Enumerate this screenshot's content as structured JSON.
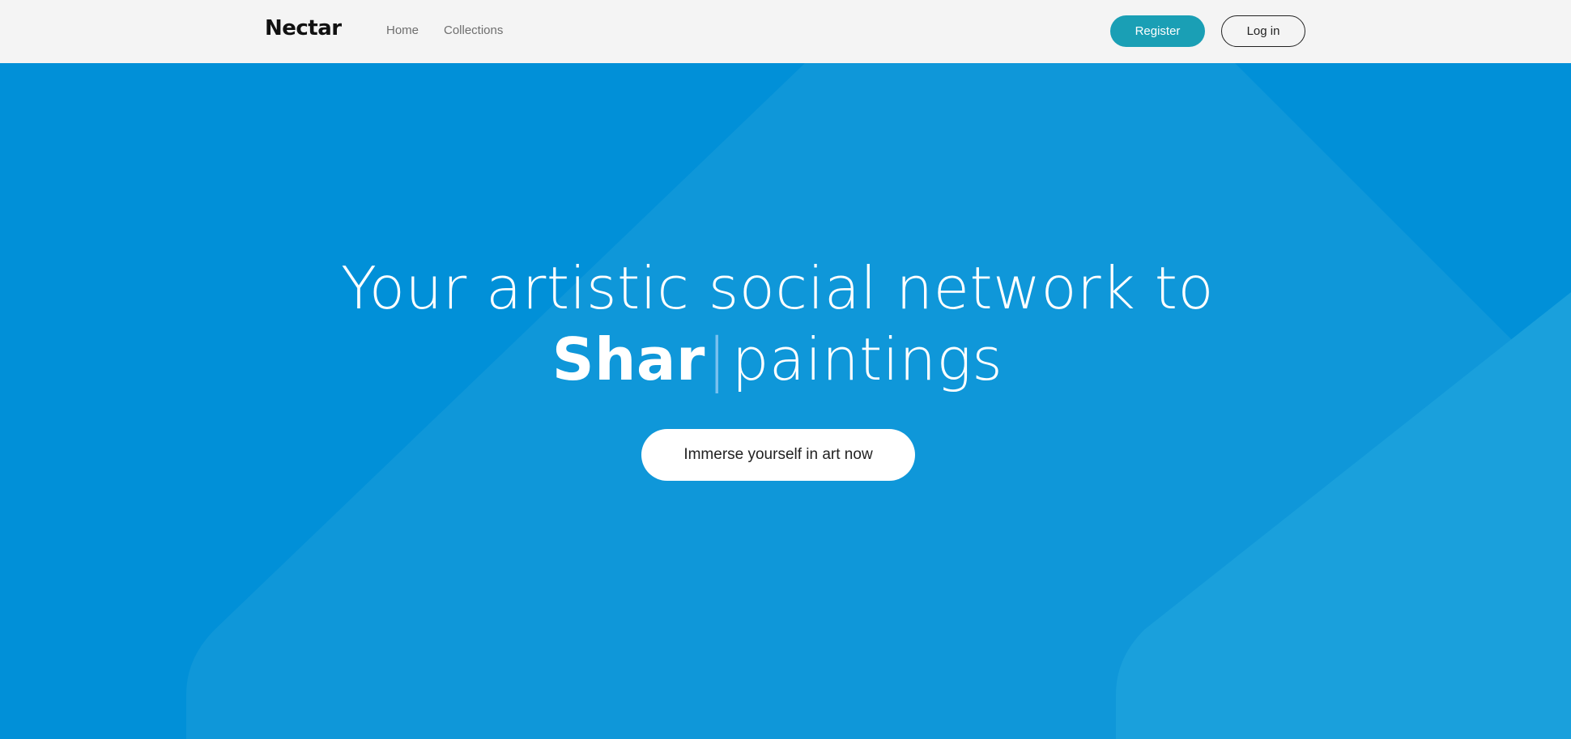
{
  "nav": {
    "logo": "Nectar",
    "links": [
      "Home",
      "Collections"
    ],
    "register_label": "Register",
    "login_label": "Log in"
  },
  "hero": {
    "line1": "Your artistic social network to",
    "typed_word": "Shar",
    "caret": "|",
    "line2_rest": "paintings",
    "cta_label": "Immerse yourself in art now"
  },
  "colors": {
    "nav_bg": "#f4f4f4",
    "hero_bg": "#0190d8",
    "register_bg": "#1a9fb5",
    "shape_light": "#1aa0dc",
    "shape_mid": "#0f97d9"
  }
}
